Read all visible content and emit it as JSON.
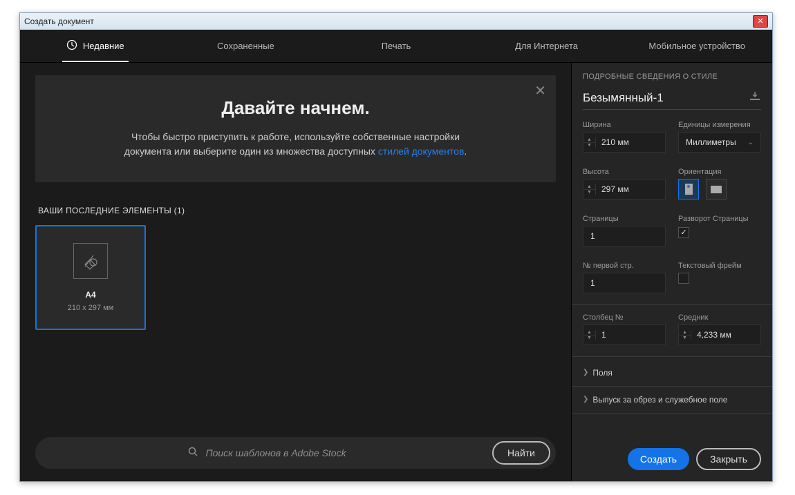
{
  "window_title": "Создать документ",
  "tabs": {
    "recent": "Недавние",
    "saved": "Сохраненные",
    "print": "Печать",
    "web": "Для Интернета",
    "mobile": "Мобильное устройство"
  },
  "hero": {
    "title": "Давайте начнем.",
    "line1": "Чтобы быстро приступить к работе, используйте собственные настройки",
    "line2a": "документа или выберите один из множества доступных ",
    "link": "стилей документов",
    "period": "."
  },
  "recent_section_title": "ВАШИ ПОСЛЕДНИЕ ЭЛЕМЕНТЫ  (1)",
  "preset": {
    "name": "A4",
    "size": "210 x 297 мм"
  },
  "search": {
    "placeholder": "Поиск шаблонов в Adobe Stock",
    "button": "Найти"
  },
  "details": {
    "heading": "ПОДРОБНЫЕ СВЕДЕНИЯ О СТИЛЕ",
    "name": "Безымянный-1",
    "width_label": "Ширина",
    "width_value": "210 мм",
    "units_label": "Единицы измерения",
    "units_value": "Миллиметры",
    "height_label": "Высота",
    "height_value": "297 мм",
    "orientation_label": "Ориентация",
    "pages_label": "Страницы",
    "pages_value": "1",
    "facing_label": "Разворот Страницы",
    "facing_checked": "✓",
    "startpage_label": "№ первой стр.",
    "startpage_value": "1",
    "textframe_label": "Текстовый фрейм",
    "columns_label": "Столбец №",
    "columns_value": "1",
    "gutter_label": "Средник",
    "gutter_value": "4,233 мм",
    "margins_expand": "Поля",
    "bleed_expand": "Выпуск за обрез и служебное поле"
  },
  "buttons": {
    "create": "Создать",
    "close": "Закрыть"
  }
}
